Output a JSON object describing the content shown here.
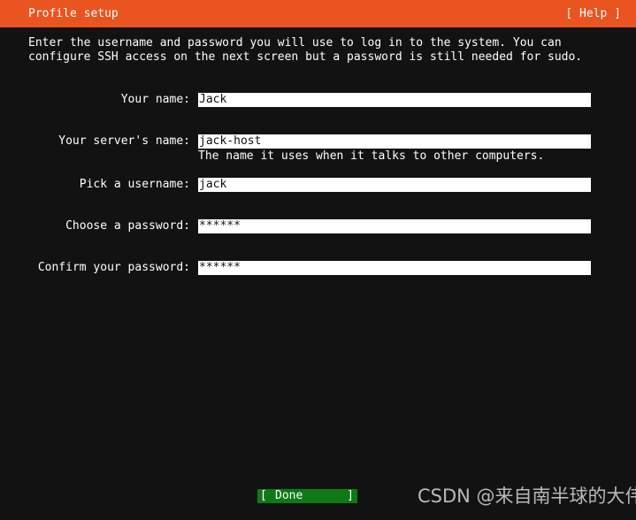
{
  "header": {
    "title": "Profile setup",
    "help_label": "[ Help ]",
    "bg_color": "#e95420",
    "fg_color": "#ffffff"
  },
  "body": {
    "bg_color": "#121212",
    "fg_color": "#ffffff",
    "intro_text": "Enter the username and password you will use to log in to the system. You can configure SSH access on the next screen but a password is still needed for sudo."
  },
  "form": {
    "fields": [
      {
        "label": "Your name:",
        "value": "Jack",
        "focused": false,
        "hint": ""
      },
      {
        "label": "Your server's name:",
        "value": "jack-host",
        "focused": true,
        "hint": "The name it uses when it talks to other computers."
      },
      {
        "label": "Pick a username:",
        "value": "jack",
        "focused": false,
        "hint": ""
      },
      {
        "label": "Choose a password:",
        "value": "******",
        "focused": false,
        "hint": ""
      },
      {
        "label": "Confirm your password:",
        "value": "******",
        "focused": false,
        "hint": ""
      }
    ]
  },
  "footer": {
    "done_bracket_left": "[",
    "done_label": "Done",
    "done_bracket_right": "]",
    "done_bg_color": "#0d7a16",
    "watermark": "CSDN @来自南半球的大伟"
  }
}
